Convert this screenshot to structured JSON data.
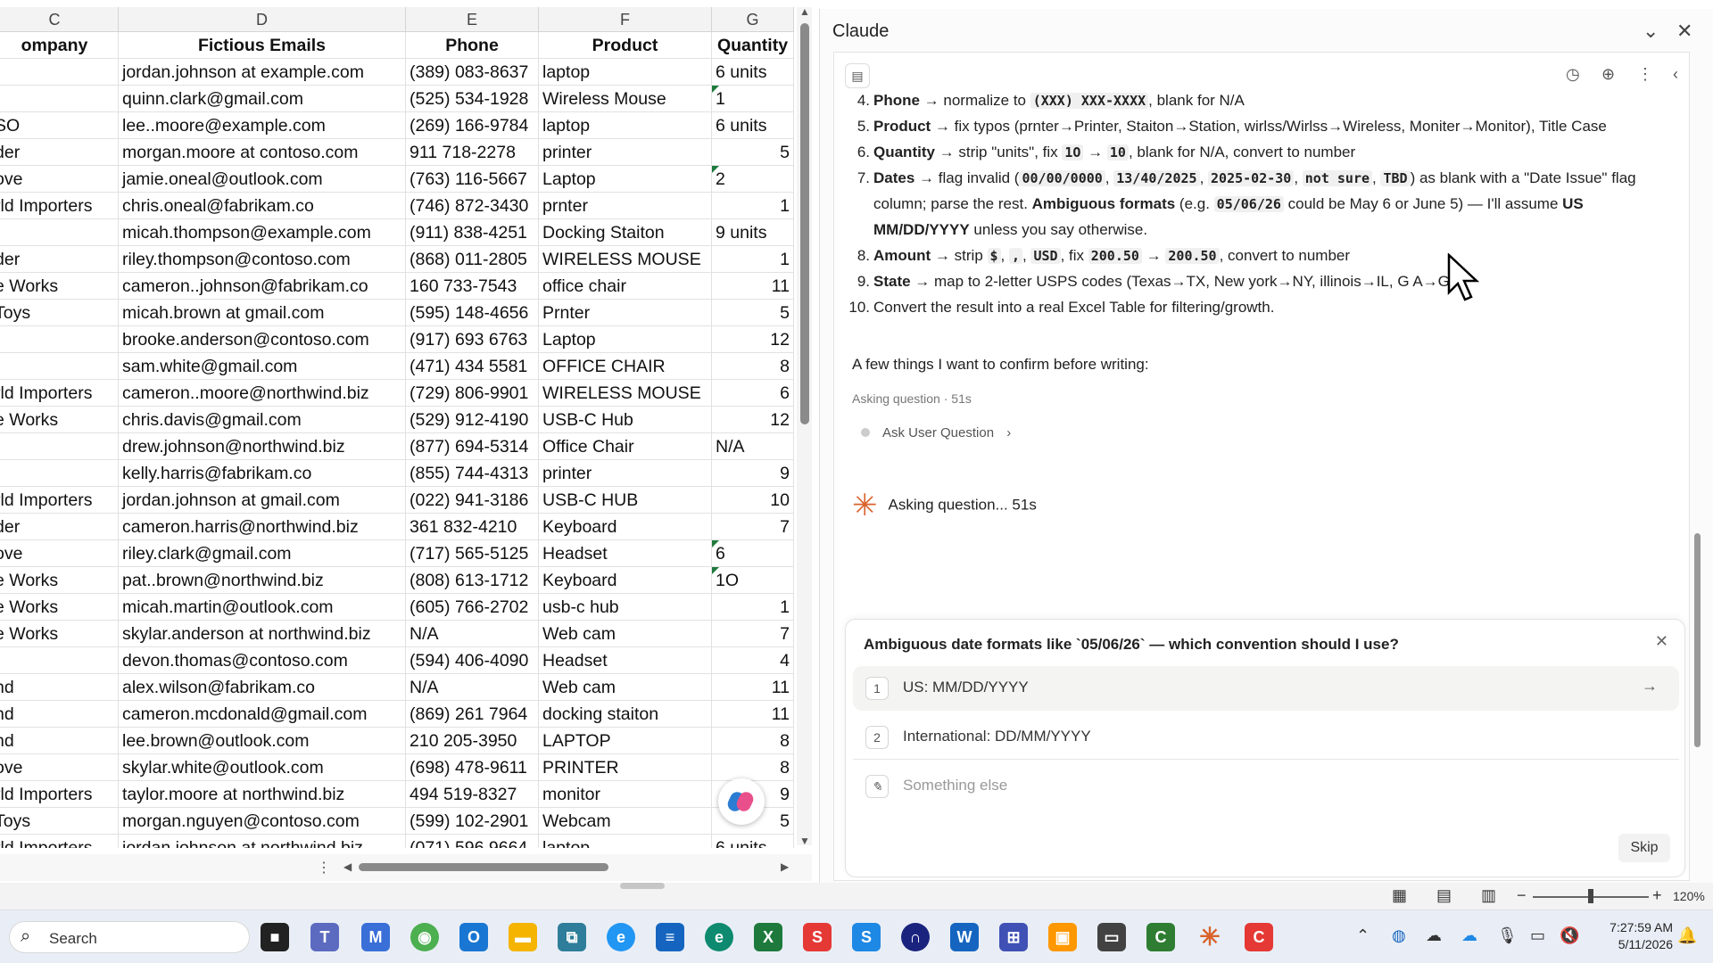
{
  "spreadsheet": {
    "columns": [
      {
        "letter": "C",
        "header": "ompany"
      },
      {
        "letter": "D",
        "header": "Fictious Emails"
      },
      {
        "letter": "E",
        "header": "Phone"
      },
      {
        "letter": "F",
        "header": "Product"
      },
      {
        "letter": "G",
        "header": "Quantity"
      }
    ],
    "rows": [
      [
        "",
        "jordan.johnson at example.com",
        "(389) 083-8637",
        "laptop",
        "6 units"
      ],
      [
        "",
        " quinn.clark@gmail.com",
        "(525) 534-1928",
        " Wireless Mouse",
        "1"
      ],
      [
        "SO",
        "lee..moore@example.com",
        "(269) 166-9784",
        "laptop",
        "6 units"
      ],
      [
        "der",
        "morgan.moore at contoso.com",
        "911 718-2278",
        "printer",
        "5"
      ],
      [
        "ove",
        "jamie.oneal@outlook.com",
        "(763) 116-5667",
        "Laptop",
        "2"
      ],
      [
        "rld Importers",
        "chris.oneal@fabrikam.co",
        "(746) 872-3430",
        "prnter",
        "1"
      ],
      [
        "",
        "micah.thompson@example.com",
        "(911) 838-4251",
        "Docking Staiton",
        "9 units"
      ],
      [
        "der",
        "riley.thompson@contoso.com",
        "(868) 011-2805",
        "WIRELESS MOUSE",
        "1"
      ],
      [
        "e Works",
        "cameron..johnson@fabrikam.co",
        "160 733-7543",
        "office chair",
        "11"
      ],
      [
        "Toys",
        "micah.brown at gmail.com",
        "(595) 148-4656",
        "Prnter",
        "5"
      ],
      [
        "",
        "brooke.anderson@contoso.com",
        "(917) 693 6763",
        "Laptop",
        "12"
      ],
      [
        "",
        "sam.white@gmail.com",
        "(471) 434 5581",
        "OFFICE  CHAIR",
        "8"
      ],
      [
        "rld Importers",
        "cameron..moore@northwind.biz",
        "(729) 806-9901",
        "WIRELESS  MOUSE",
        "6"
      ],
      [
        "e Works",
        "chris.davis@gmail.com",
        "(529) 912-4190",
        "USB-C Hub",
        "12"
      ],
      [
        "",
        " drew.johnson@northwind.biz",
        "(877) 694-5314",
        "Office Chair",
        "N/A"
      ],
      [
        "",
        "kelly.harris@fabrikam.co",
        "(855)  744-4313",
        "printer",
        "9"
      ],
      [
        "rld Importers",
        "jordan.johnson at gmail.com",
        "(022) 941-3186",
        "USB-C HUB",
        "10"
      ],
      [
        "der",
        "cameron.harris@northwind.biz",
        "361 832-4210",
        "Keyboard",
        "7"
      ],
      [
        "ove",
        "riley.clark@gmail.com",
        "(717) 565-5125",
        "Headset",
        "6"
      ],
      [
        "e Works",
        "pat..brown@northwind.biz",
        "(808) 613-1712",
        " Keyboard",
        "1O"
      ],
      [
        "e Works",
        "micah.martin@outlook.com",
        "(605) 766-2702",
        " usb-c hub",
        "1"
      ],
      [
        "e Works",
        "skylar.anderson at northwind.biz",
        "N/A",
        " Web cam",
        "7"
      ],
      [
        "",
        "devon.thomas@contoso.com",
        "(594) 406-4090",
        " Headset",
        "4"
      ],
      [
        "nd",
        "alex.wilson@fabrikam.co",
        "N/A",
        "Web cam",
        "11"
      ],
      [
        "nd",
        "cameron.mcdonald@gmail.com",
        "(869) 261 7964",
        " docking staiton",
        "11"
      ],
      [
        "nd",
        " lee.brown@outlook.com",
        "210 205-3950",
        " LAPTOP",
        "8"
      ],
      [
        "ove",
        "skylar.white@outlook.com",
        "(698) 478-9611",
        " PRINTER",
        "8"
      ],
      [
        "rld Importers",
        "taylor.moore at northwind.biz",
        "494 519-8327",
        " monitor",
        "9"
      ],
      [
        "Toys",
        "morgan.nguyen@contoso.com",
        "(599)  102-2901",
        " Webcam",
        "5"
      ],
      [
        "rld Importers",
        "jordan.johnson at northwind.biz",
        "(071) 596 9664",
        "laptop",
        "6 units"
      ]
    ],
    "text_quantity_rows": [
      1,
      4,
      14,
      18,
      19
    ]
  },
  "panel": {
    "title": "Claude",
    "list": [
      {
        "n": "4.",
        "html": "<b>Phone</b> → normalize to <code>(XXX) XXX-XXXX</code>, blank for N/A"
      },
      {
        "n": "5.",
        "html": "<b>Product</b> → fix typos (prnter→Printer, Staiton→Station, wirlss/Wirlss→Wireless, Moniter→Monitor), Title Case"
      },
      {
        "n": "6.",
        "html": "<b>Quantity</b> → strip \"units\", fix <code>1O</code> → <code>10</code>, blank for N/A, convert to number"
      },
      {
        "n": "7.",
        "html": "<b>Dates</b> → flag invalid (<code>00/00/0000</code>, <code>13/40/2025</code>, <code>2025-02-30</code>, <code>not sure</code>, <code>TBD</code>) as blank with a \"Date Issue\" flag"
      },
      {
        "n": "",
        "html": "column; parse the rest. <b>Ambiguous formats</b> (e.g. <code>05/06/26</code> could be May 6 or June 5) — I'll assume <b>US</b>"
      },
      {
        "n": "",
        "html": "<b>MM/DD/YYYY</b> unless you say otherwise."
      },
      {
        "n": "8.",
        "html": "<b>Amount</b> → strip <code>$</code>, <code>,</code>, <code>USD</code>, fix <code>200.50</code> → <code>200.50</code>, convert to number"
      },
      {
        "n": "9.",
        "html": "<b>State</b> → map to 2-letter USPS codes (Texas→TX, New york→NY, illinois→IL, G A→GA)"
      },
      {
        "n": "10.",
        "html": "Convert the result into a real Excel Table for filtering/growth."
      }
    ],
    "confirm": "A few things I want to confirm before writing:",
    "ask_meta": "Asking question · 51s",
    "ask_tool": "Ask User Question",
    "asking_status": "Asking question... 51s",
    "question": "Ambiguous date formats like `05/06/26` — which convention should I use?",
    "options": [
      {
        "num": "1",
        "label": "US: MM/DD/YYYY"
      },
      {
        "num": "2",
        "label": "International: DD/MM/YYYY"
      }
    ],
    "other_label": "Something else",
    "skip": "Skip"
  },
  "status": {
    "zoom": "120%"
  },
  "taskbar": {
    "search_placeholder": "Search",
    "time": "7:27:59 AM",
    "date": "5/11/2026"
  },
  "colors": {
    "accent": "#d9622b",
    "excel_green": "#1e7a3c"
  }
}
